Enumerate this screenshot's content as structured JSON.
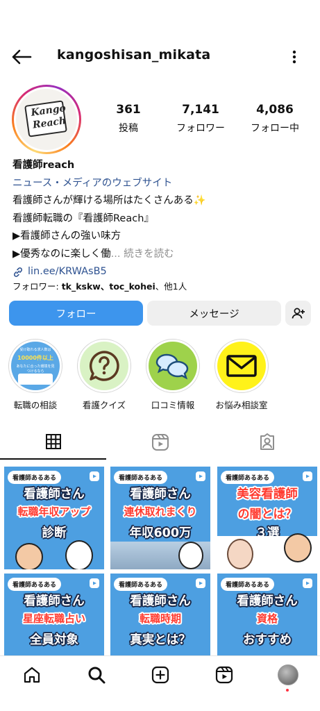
{
  "header": {
    "username": "kangoshisan_mikata"
  },
  "profile": {
    "avatar_logo_line1": "Kango",
    "avatar_logo_line2": "Reach",
    "stats": {
      "posts": {
        "value": "361",
        "label": "投稿"
      },
      "followers": {
        "value": "7,141",
        "label": "フォロワー"
      },
      "following": {
        "value": "4,086",
        "label": "フォロー中"
      }
    }
  },
  "bio": {
    "name": "看護師reach",
    "category": "ニュース・メディアのウェブサイト",
    "line1": "看護師さんが輝ける場所はたくさんある✨",
    "line2": "看護師転職の『看護師Reach』",
    "line3": "▶看護師さんの強い味方",
    "line4": "▶優秀なのに楽しく働",
    "more": "... 続きを読む",
    "link": "lin.ee/KRWAsB5",
    "followed_by_prefix": "フォロワー: ",
    "followed_by_names": "tk_kskw、toc_kohei",
    "followed_by_suffix": "、他1人"
  },
  "buttons": {
    "follow": "フォロー",
    "message": "メッセージ"
  },
  "highlights": [
    {
      "label": "転職の相談",
      "text_a": "受け取れる求人数は",
      "text_b": "10000件以上",
      "text_c": "あなたに合った環境を見つけるなら"
    },
    {
      "label": "看護クイズ",
      "icon": "question-icon"
    },
    {
      "label": "口コミ情報",
      "icon": "chat-bubbles-icon"
    },
    {
      "label": "お悩み相談室",
      "icon": "envelope-icon"
    }
  ],
  "posts": [
    {
      "tag": "看護師あるある",
      "l1": "看護師さん",
      "l2": "転職年収アップ",
      "l3": "診断"
    },
    {
      "tag": "看護師あるある",
      "l1": "看護師さん",
      "l2": "連休取れまくり",
      "l3": "年収600万"
    },
    {
      "tag": "看護師あるある",
      "l1": "美容看護師",
      "l2": "の闇とは？",
      "l3": "３選"
    },
    {
      "tag": "看護師あるある",
      "l1": "看護師さん",
      "l2": "星座転職占い",
      "l3": "全員対象"
    },
    {
      "tag": "看護師あるある",
      "l1": "看護師さん",
      "l2": "転職時期",
      "l3": "真実とは？"
    },
    {
      "tag": "看護師あるある",
      "l1": "看護師さん",
      "l2": "資格",
      "l3": "おすすめ"
    }
  ],
  "colors": {
    "accent": "#3d95ed",
    "link": "#2f5391",
    "post_bg": "#4d9fe1",
    "notification": "#ff3040"
  }
}
